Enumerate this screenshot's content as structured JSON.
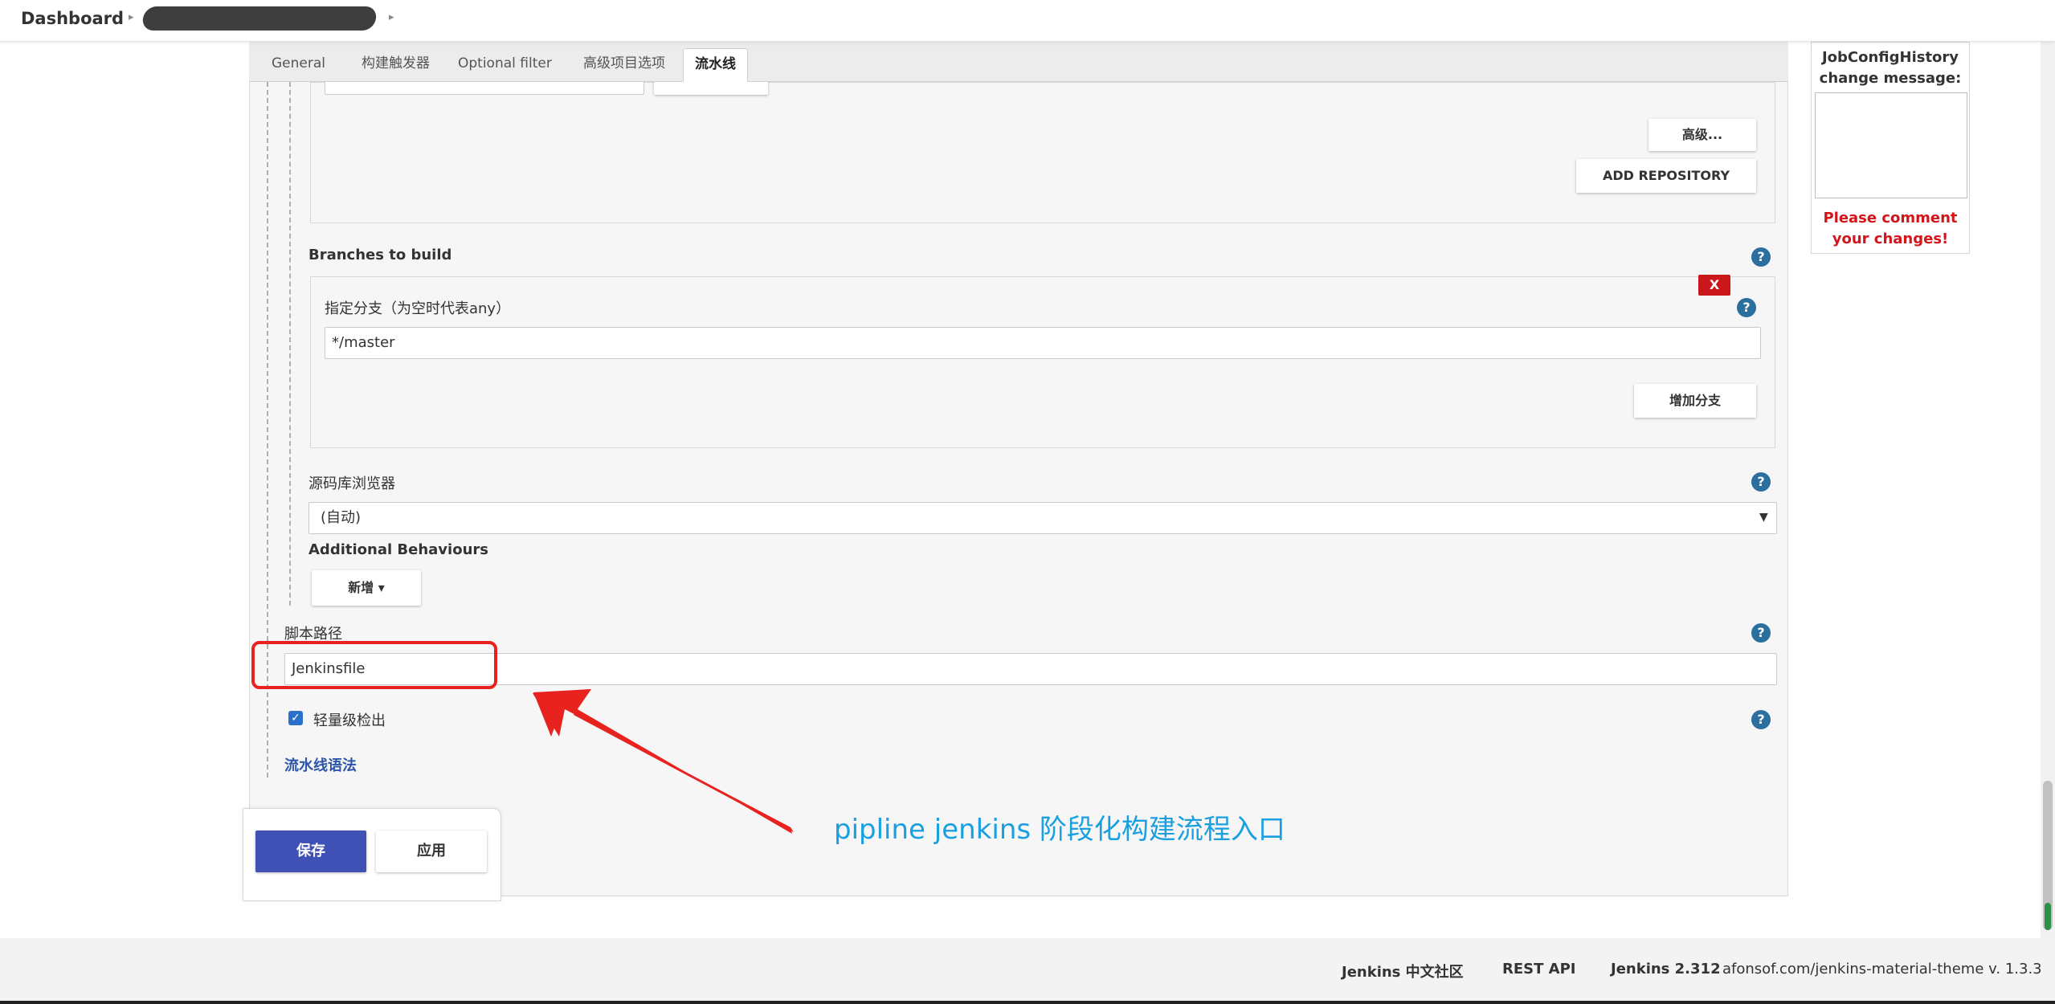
{
  "breadcrumb": {
    "dashboard": "Dashboard"
  },
  "tabs": [
    {
      "label": "General"
    },
    {
      "label": "构建触发器"
    },
    {
      "label": "Optional filter"
    },
    {
      "label": "高级项目选项"
    },
    {
      "label": "流水线"
    }
  ],
  "repository": {
    "advanced_button": "高级...",
    "add_repository_button": "ADD REPOSITORY"
  },
  "branches": {
    "title": "Branches to build",
    "remove_button": "X",
    "branch_label": "指定分支（为空时代表any）",
    "branch_value": "*/master",
    "add_branch_button": "增加分支"
  },
  "browser": {
    "label": "源码库浏览器",
    "selected": "(自动)"
  },
  "behaviours": {
    "label": "Additional Behaviours",
    "add_button": "新增 ▾"
  },
  "script_path": {
    "label": "脚本路径",
    "value": "Jenkinsfile"
  },
  "lightweight": {
    "label": "轻量级检出",
    "checked": true
  },
  "pipeline_syntax_link": "流水线语法",
  "actions": {
    "save": "保存",
    "apply": "应用"
  },
  "annotation_text": "pipline jenkins 阶段化构建流程入口",
  "side_panel": {
    "title": "JobConfigHistory change message:",
    "warning": "Please comment your changes!"
  },
  "footer": {
    "community": "Jenkins 中文社区",
    "rest_api": "REST API",
    "version": "Jenkins 2.312",
    "theme": "afonsof.com/jenkins-material-theme v. 1.3.3"
  },
  "colors": {
    "primary": "#3f51b5",
    "danger": "#c9171c",
    "help": "#2a6f9e",
    "annotation": "#1a9fe0",
    "highlight": "#e8231f"
  }
}
